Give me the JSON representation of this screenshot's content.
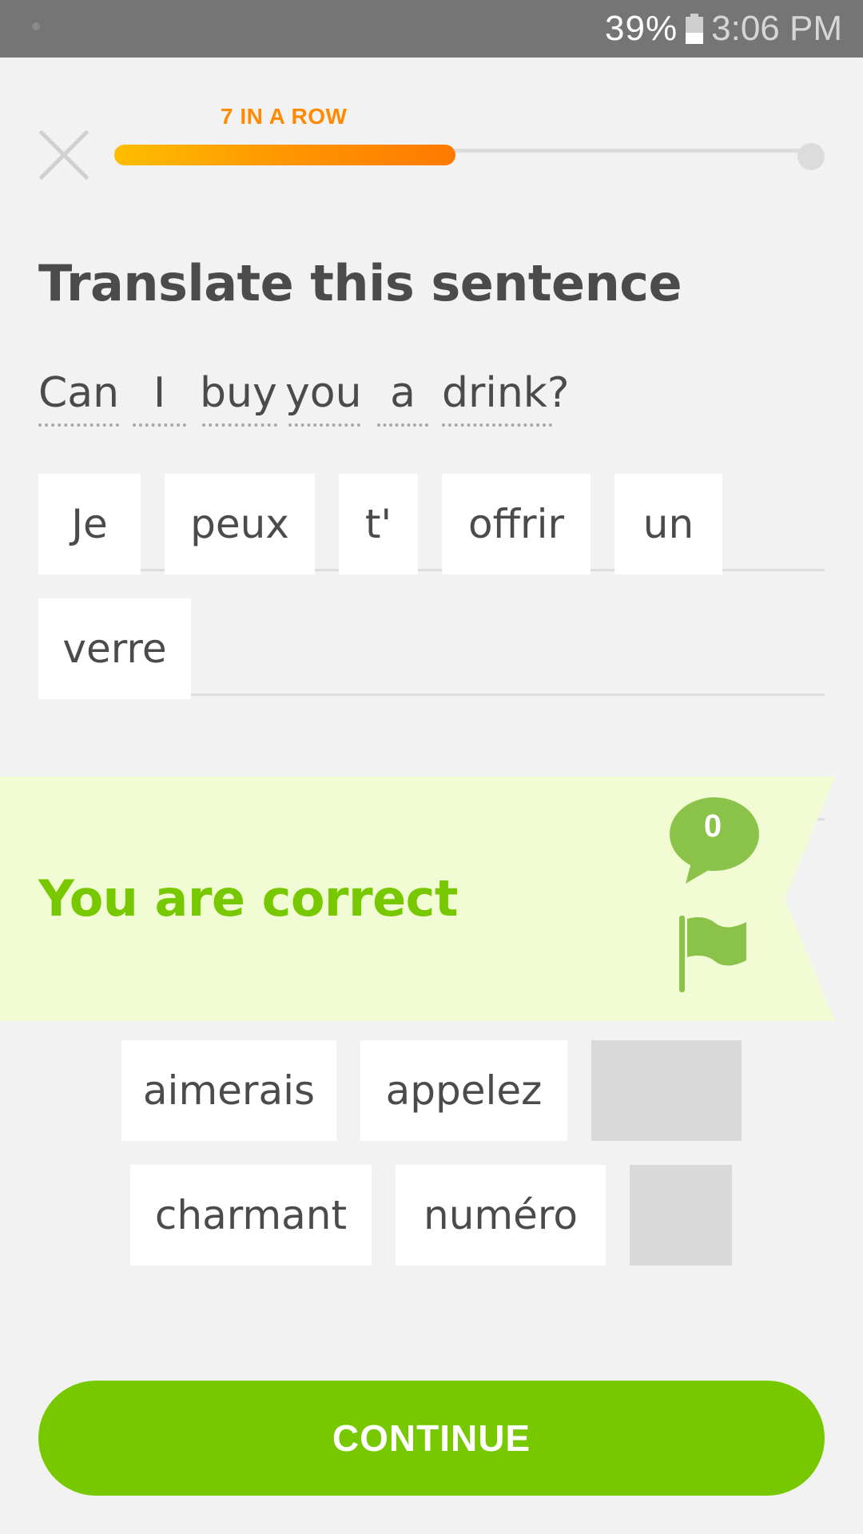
{
  "status_bar": {
    "battery_percent": "39%",
    "time": "3:06 PM"
  },
  "header": {
    "streak_label": "7 IN A ROW",
    "progress": 0.49
  },
  "prompt": {
    "title": "Translate this sentence",
    "sentence_words": [
      "Can",
      "I",
      "buy",
      "you",
      "a",
      "drink?"
    ]
  },
  "answer": {
    "tiles": [
      "Je",
      "peux",
      "t'",
      "offrir",
      "un",
      "verre"
    ]
  },
  "feedback": {
    "message": "You are correct",
    "comment_count": "0"
  },
  "word_bank": {
    "tiles": [
      "aimerais",
      "appelez",
      "charmant",
      "numéro"
    ]
  },
  "footer": {
    "continue_label": "CONTINUE"
  },
  "colors": {
    "accent_green": "#78c800",
    "streak_orange": "#ff8a00",
    "banner_bg": "#f1fbd4"
  }
}
